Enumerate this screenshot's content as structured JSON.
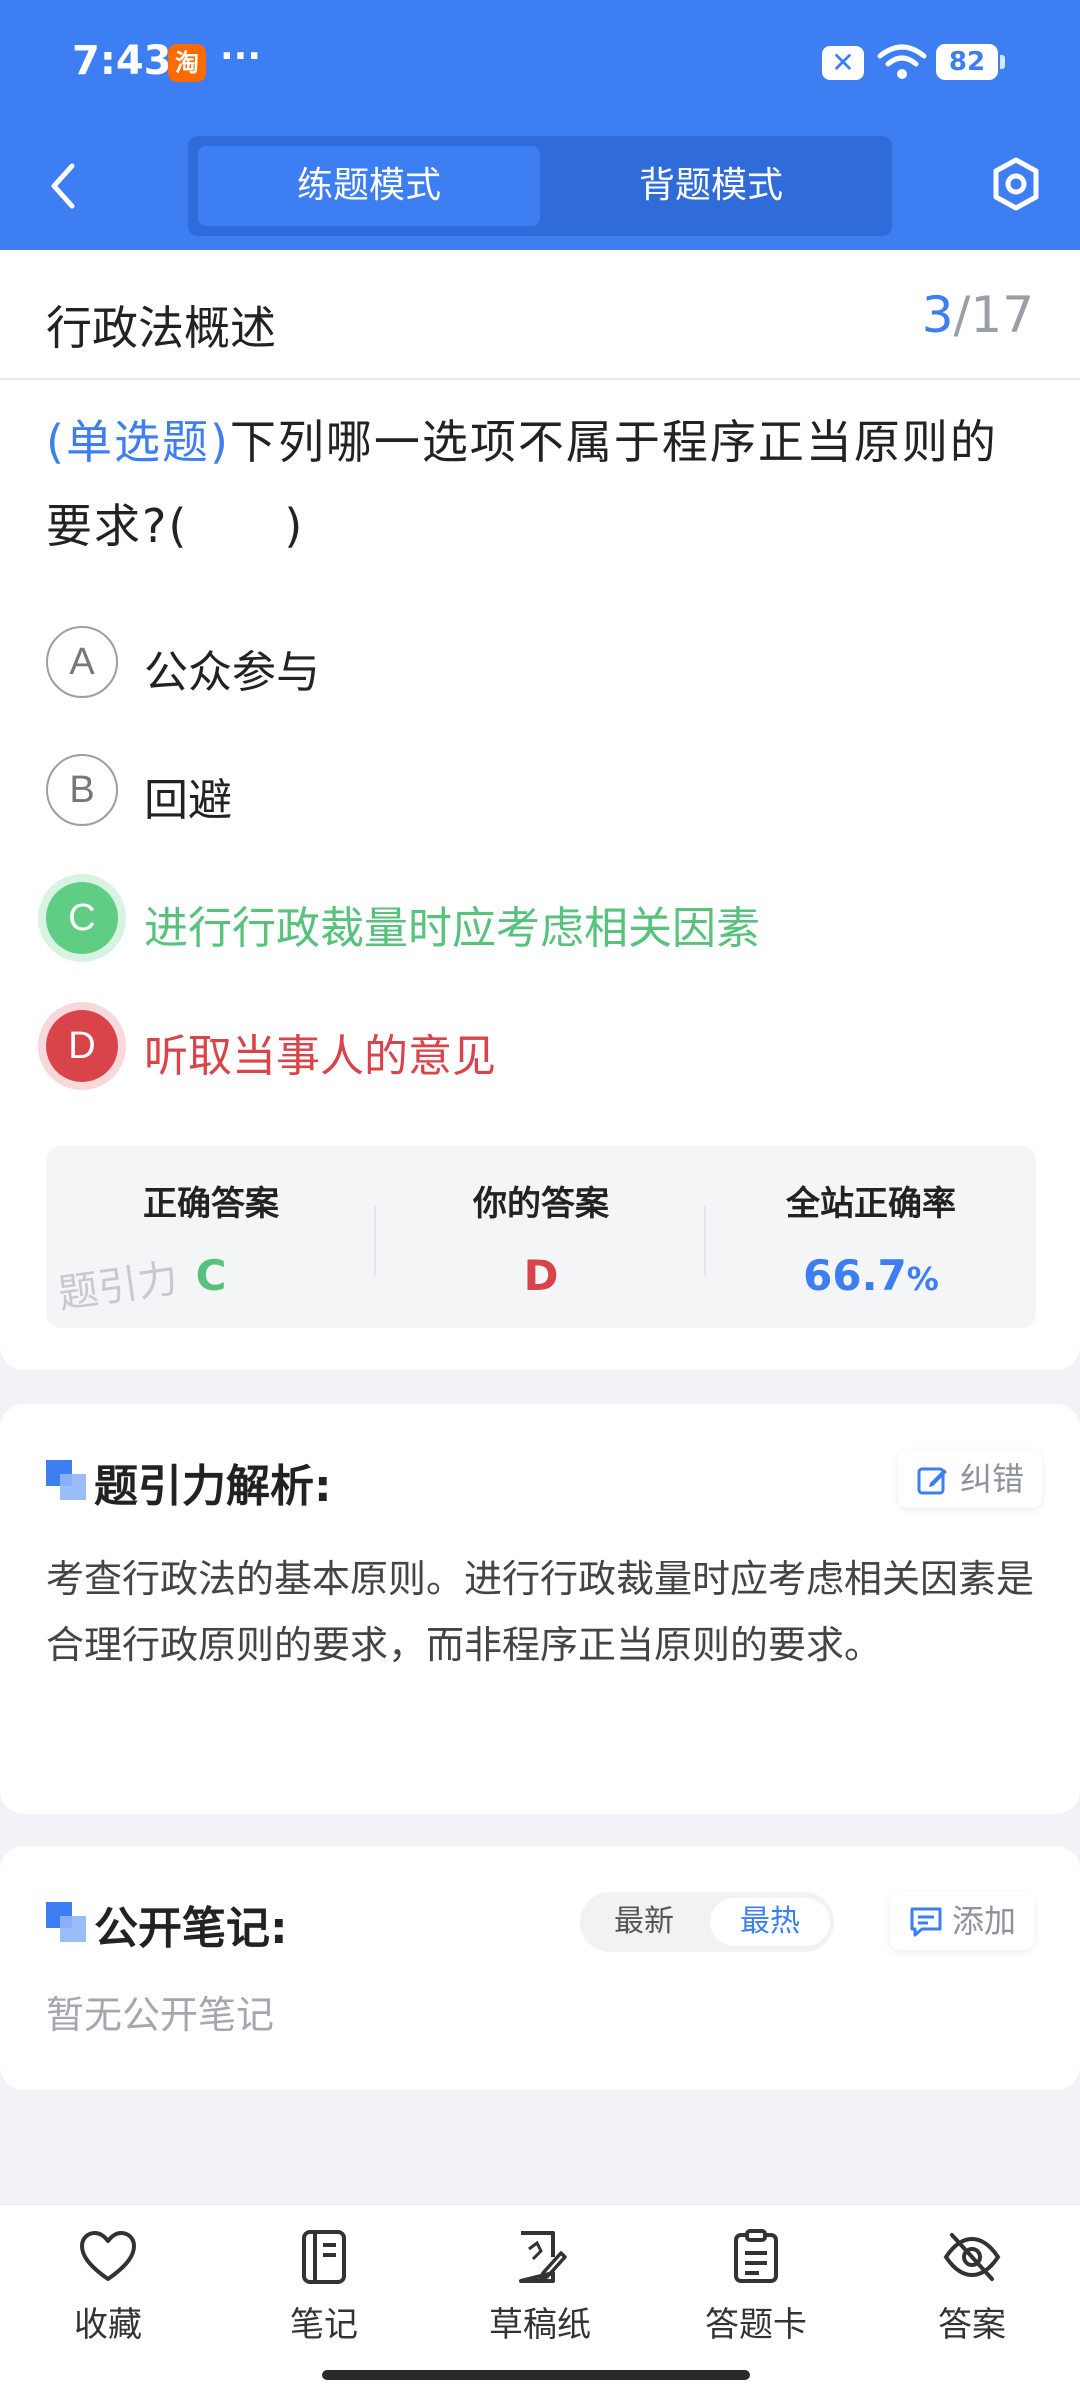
{
  "status_bar": {
    "time": "7:43",
    "app_badge": "淘",
    "more": "···",
    "battery": "82"
  },
  "header": {
    "modes": [
      "练题模式",
      "背题模式"
    ],
    "active_mode_index": 0,
    "accent_color": "#3d7ef3"
  },
  "question": {
    "section": "行政法概述",
    "current": "3",
    "total": "/17",
    "type_label": "(单选题)",
    "text": "下列哪一选项不属于程序正当原则的要求?(　　)",
    "options": [
      {
        "letter": "A",
        "text": "公众参与",
        "state": "normal"
      },
      {
        "letter": "B",
        "text": "回避",
        "state": "normal"
      },
      {
        "letter": "C",
        "text": "进行行政裁量时应考虑相关因素",
        "state": "correct"
      },
      {
        "letter": "D",
        "text": "听取当事人的意见",
        "state": "wrong"
      }
    ]
  },
  "stats": {
    "correct_label": "正确答案",
    "correct_value": "C",
    "yours_label": "你的答案",
    "yours_value": "D",
    "rate_label": "全站正确率",
    "rate_value": "66.7",
    "rate_unit": "%",
    "watermark": "题引力"
  },
  "analysis": {
    "title": "题引力解析:",
    "report_label": "纠错",
    "text": "考查行政法的基本原则。进行行政裁量时应考虑相关因素是合理行政原则的要求，而非程序正当原则的要求。"
  },
  "notes": {
    "title": "公开笔记:",
    "sort_latest": "最新",
    "sort_hot": "最热",
    "add_label": "添加",
    "empty_text": "暂无公开笔记"
  },
  "bottom_nav": [
    {
      "label": "收藏",
      "icon": "heart-icon"
    },
    {
      "label": "笔记",
      "icon": "notebook-icon"
    },
    {
      "label": "草稿纸",
      "icon": "draft-paper-icon"
    },
    {
      "label": "答题卡",
      "icon": "answer-card-icon"
    },
    {
      "label": "答案",
      "icon": "eye-off-icon"
    }
  ]
}
